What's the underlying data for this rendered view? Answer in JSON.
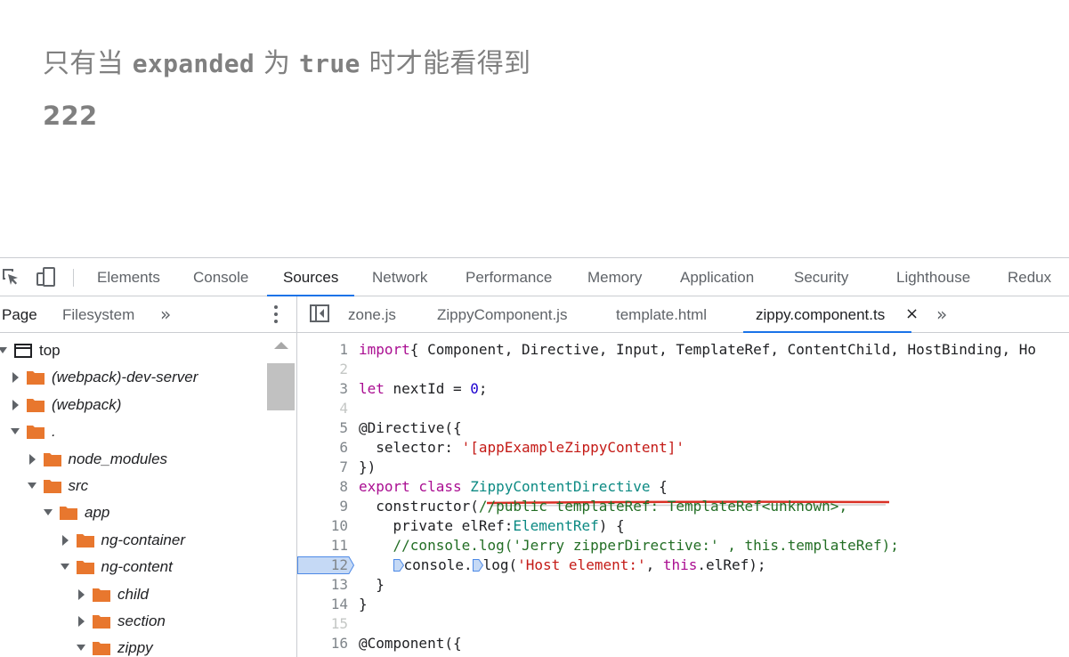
{
  "page": {
    "line1_cn_a": "只有当",
    "line1_code_a": "expanded",
    "line1_cn_b": "为",
    "line1_code_b": "true",
    "line1_cn_c": "时才能看得到",
    "line2": "222"
  },
  "devtools": {
    "toolbar_icons": [
      "inspect-element-icon",
      "device-toolbar-icon"
    ],
    "tabs": [
      "Elements",
      "Console",
      "Sources",
      "Network",
      "Performance",
      "Memory",
      "Application",
      "Security",
      "Lighthouse",
      "Redux"
    ],
    "active_tab": "Sources",
    "accent_color": "#1a73e8"
  },
  "navigator": {
    "tabs": [
      "Page",
      "Filesystem"
    ],
    "more": "»",
    "tree": [
      {
        "label": "top",
        "icon": "frame-icon",
        "expanded": true
      },
      {
        "label": "(webpack)-dev-server",
        "icon": "folder-icon",
        "expanded": false
      },
      {
        "label": "(webpack)",
        "icon": "folder-icon",
        "expanded": false
      },
      {
        "label": ".",
        "icon": "folder-icon",
        "expanded": true
      },
      {
        "label": "node_modules",
        "icon": "folder-icon",
        "expanded": false
      },
      {
        "label": "src",
        "icon": "folder-icon",
        "expanded": true
      },
      {
        "label": "app",
        "icon": "folder-icon",
        "expanded": true
      },
      {
        "label": "ng-container",
        "icon": "folder-icon",
        "expanded": false
      },
      {
        "label": "ng-content",
        "icon": "folder-icon",
        "expanded": true
      },
      {
        "label": "child",
        "icon": "folder-icon",
        "expanded": false
      },
      {
        "label": "section",
        "icon": "folder-icon",
        "expanded": false
      },
      {
        "label": "zippy",
        "icon": "folder-icon",
        "expanded": true
      }
    ],
    "folder_color": "#e8772e"
  },
  "editor": {
    "tabs": [
      "zone.js",
      "ZippyComponent.js",
      "template.html",
      "zippy.component.ts"
    ],
    "active_tab": "zippy.component.ts",
    "close": "×",
    "more": "»",
    "active_line": 12,
    "lines": [
      {
        "n": "1",
        "parts": [
          [
            "kw",
            "import"
          ],
          [
            "",
            "{ Component, Directive, Input, TemplateRef, ContentChild, HostBinding, Ho"
          ]
        ]
      },
      {
        "n": "2",
        "parts": []
      },
      {
        "n": "3",
        "parts": [
          [
            "kw",
            "let"
          ],
          [
            "",
            " nextId = "
          ],
          [
            "num",
            "0"
          ],
          [
            "",
            ";"
          ]
        ]
      },
      {
        "n": "4",
        "parts": []
      },
      {
        "n": "5",
        "parts": [
          [
            "",
            "@Directive({"
          ]
        ]
      },
      {
        "n": "6",
        "parts": [
          [
            "",
            "  selector: "
          ],
          [
            "str",
            "'[appExampleZippyContent]'"
          ]
        ]
      },
      {
        "n": "7",
        "parts": [
          [
            "",
            "})"
          ]
        ]
      },
      {
        "n": "8",
        "parts": [
          [
            "kw",
            "export class"
          ],
          [
            "",
            " "
          ],
          [
            "typ",
            "ZippyContentDirective"
          ],
          [
            "",
            " {"
          ]
        ]
      },
      {
        "n": "9",
        "parts": [
          [
            "",
            "  constructor("
          ],
          [
            "cmt",
            "//public templateRef: TemplateRef<unknown>,"
          ]
        ]
      },
      {
        "n": "10",
        "parts": [
          [
            "",
            "    private elRef:"
          ],
          [
            "typ",
            "ElementRef"
          ],
          [
            "",
            ") {"
          ]
        ]
      },
      {
        "n": "11",
        "parts": [
          [
            "cmt",
            "    //console.log('Jerry zipperDirective:' , this.templateRef);"
          ]
        ]
      },
      {
        "n": "12",
        "parts": [
          [
            "",
            "    "
          ],
          [
            "bp",
            ""
          ],
          [
            "",
            "console."
          ],
          [
            "bp",
            ""
          ],
          [
            "",
            "log("
          ],
          [
            "str",
            "'Host element:'"
          ],
          [
            "",
            ", "
          ],
          [
            "kw",
            "this"
          ],
          [
            "",
            ".elRef);"
          ]
        ]
      },
      {
        "n": "13",
        "parts": [
          [
            "",
            "  }"
          ]
        ]
      },
      {
        "n": "14",
        "parts": [
          [
            "",
            "}"
          ]
        ]
      },
      {
        "n": "15",
        "parts": []
      },
      {
        "n": "16",
        "parts": [
          [
            "",
            "@Component({"
          ]
        ]
      }
    ]
  }
}
